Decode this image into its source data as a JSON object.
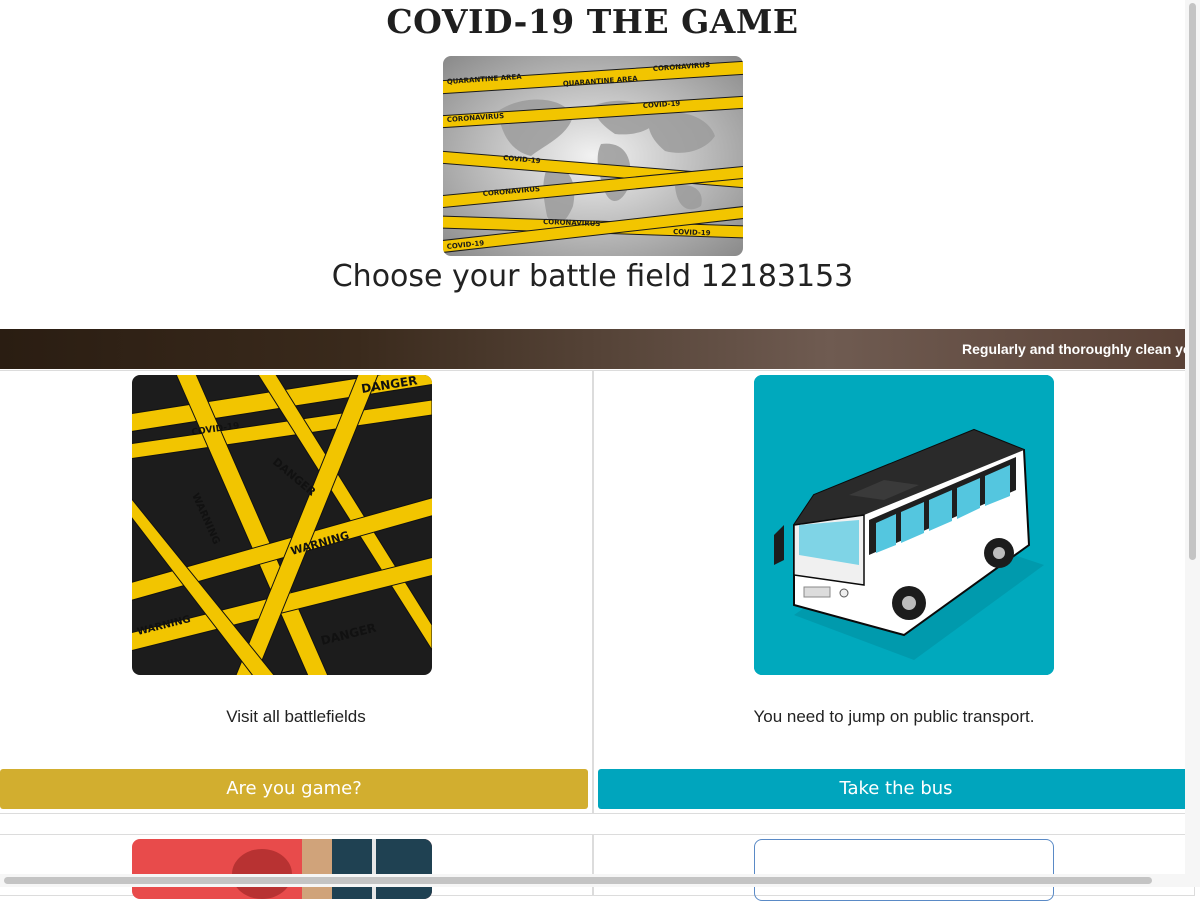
{
  "header": {
    "title": "COVID-19 THE GAME",
    "subtitle": "Choose your battle field 12183153"
  },
  "hero": {
    "icon": "quarantine-world-map-image",
    "tape_labels": [
      "QUARANTINE AREA",
      "CORONAVIRUS",
      "COVID-19"
    ]
  },
  "ticker": {
    "text": "Regularly and thoroughly clean your"
  },
  "cards": [
    {
      "icon": "danger-tape-image",
      "description": "Visit all battlefields",
      "button_label": "Are you game?",
      "button_color": "#d2ae2f",
      "tape_labels": [
        "DANGER",
        "COVID-19",
        "WARNING",
        "QUARANTINE"
      ]
    },
    {
      "icon": "bus-image",
      "description": "You need to jump on public transport.",
      "button_label": "Take the bus",
      "button_color": "#00a5bd",
      "tape_labels": []
    }
  ],
  "colors": {
    "tape_yellow": "#f2c500",
    "ticker_dark": "#2a1d12",
    "bus_bg": "#00a9bd"
  }
}
